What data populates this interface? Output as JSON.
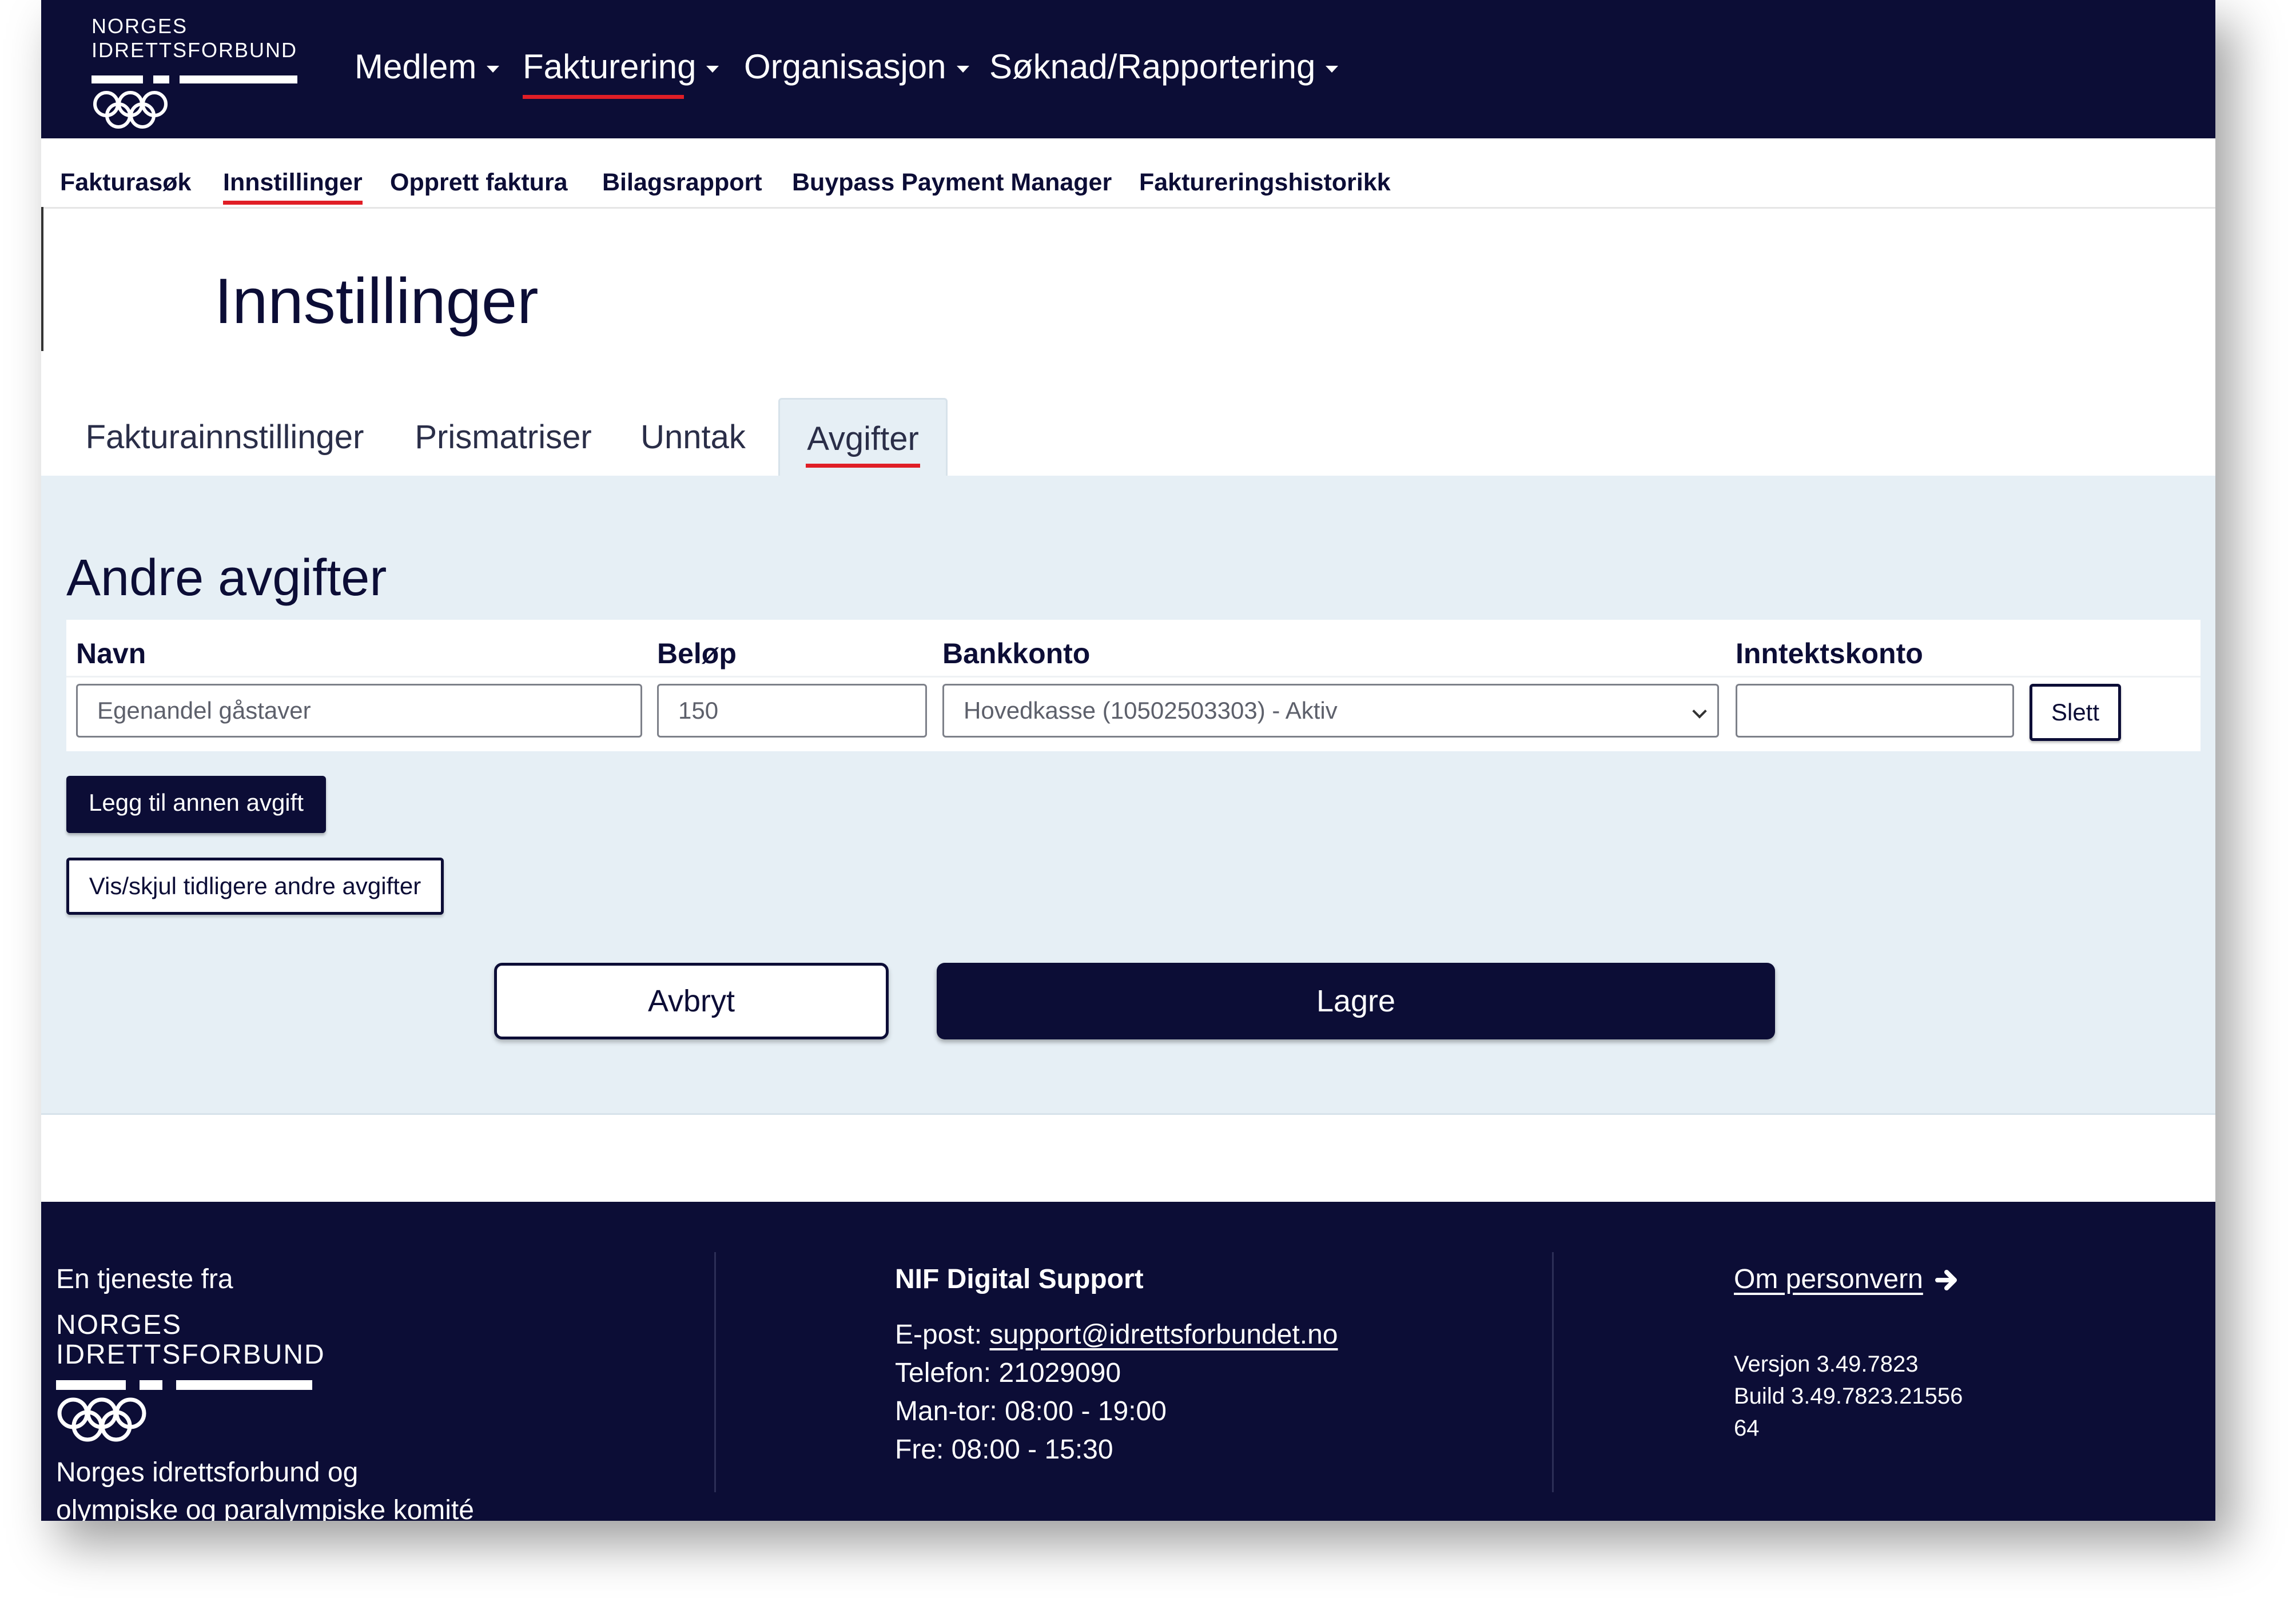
{
  "colors": {
    "navy": "#0c0d36",
    "accent_red": "#e01e26",
    "panel_bg": "#e6eff5"
  },
  "brand": {
    "logo_line1": "NORGES",
    "logo_line2": "IDRETTSFORBUND"
  },
  "main_nav": {
    "items": [
      {
        "label": "Medlem"
      },
      {
        "label": "Fakturering"
      },
      {
        "label": "Organisasjon"
      },
      {
        "label": "Søknad/Rapportering"
      }
    ],
    "active": "Fakturering"
  },
  "sub_nav": {
    "items": [
      {
        "label": "Fakturasøk"
      },
      {
        "label": "Innstillinger"
      },
      {
        "label": "Opprett faktura"
      },
      {
        "label": "Bilagsrapport"
      },
      {
        "label": "Buypass Payment Manager"
      },
      {
        "label": "Faktureringshistorikk"
      }
    ],
    "active": "Innstillinger"
  },
  "page": {
    "title": "Innstillinger"
  },
  "tabs": {
    "items": [
      {
        "label": "Fakturainnstillinger"
      },
      {
        "label": "Prismatriser"
      },
      {
        "label": "Unntak"
      },
      {
        "label": "Avgifter"
      }
    ],
    "active": "Avgifter"
  },
  "fees": {
    "section_title": "Andre avgifter",
    "columns": {
      "name": "Navn",
      "amount": "Beløp",
      "bank_account": "Bankkonto",
      "income_account": "Inntektskonto"
    },
    "rows": [
      {
        "name": "Egenandel gåstaver",
        "amount": "150",
        "bank_account": "Hovedkasse (10502503303) - Aktiv",
        "income_account": "",
        "delete_label": "Slett"
      }
    ],
    "add_label": "Legg til annen avgift",
    "toggle_label": "Vis/skjul tidligere andre avgifter"
  },
  "actions": {
    "cancel_label": "Avbryt",
    "save_label": "Lagre"
  },
  "footer": {
    "service_from": "En tjeneste fra",
    "logo_line1": "NORGES",
    "logo_line2": "IDRETTSFORBUND",
    "org_line1": "Norges idrettsforbund og",
    "org_line2": "olympiske og paralympiske komité",
    "support_title": "NIF Digital Support",
    "email_label": "E-post:",
    "email": "support@idrettsforbundet.no",
    "phone": "Telefon: 21029090",
    "hours_weekdays": "Man-tor: 08:00 - 19:00",
    "hours_friday": "Fre: 08:00 - 15:30",
    "privacy_label": "Om personvern",
    "version": "Versjon 3.49.7823",
    "build_line1": "Build 3.49.7823.21556",
    "build_line2": "64"
  }
}
